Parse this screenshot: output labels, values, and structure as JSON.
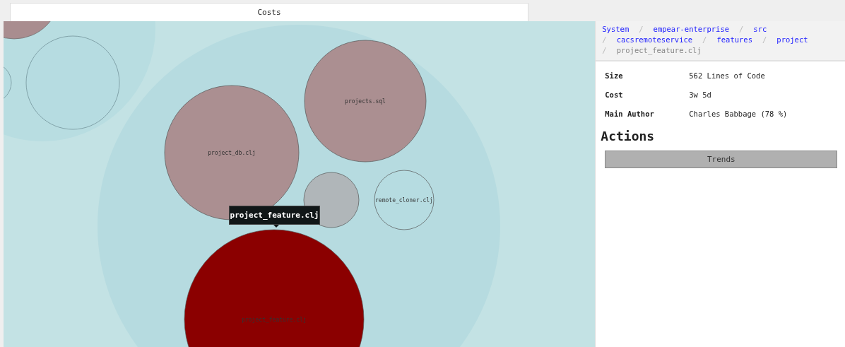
{
  "tabs": [
    {
      "label": "Costs",
      "selected": true
    }
  ],
  "files": [
    {
      "label": "projects.sql",
      "color": "#ab8f91"
    },
    {
      "label": "project_db.clj",
      "color": "#ab8f91"
    },
    {
      "color": "#b0b6b9"
    },
    {
      "label": "remote_cloner.clj",
      "color": "#b6dce1"
    },
    {
      "label": "project_feature.clj",
      "color": "#8b0000"
    }
  ],
  "tooltip": "project_feature.clj",
  "breadcrumb": [
    {
      "label": "System",
      "current": false
    },
    {
      "separator": "/",
      "label": "empear-enterprise",
      "current": false
    },
    {
      "separator": "/",
      "label": "src",
      "current": false
    },
    {
      "separator": "/",
      "label": "cacsremoteservice",
      "current": false
    },
    {
      "separator": "/",
      "label": "features",
      "current": false
    },
    {
      "separator": "/",
      "label": "project",
      "current": false
    },
    {
      "separator": "/",
      "label": "project_feature.clj",
      "current": true
    }
  ],
  "details": [
    {
      "label": "Size",
      "value": "562 Lines of Code"
    },
    {
      "label": "Cost",
      "value": "3w 5d"
    },
    {
      "label": "Main Author",
      "value": "Charles Babbage (78 %)"
    }
  ],
  "actions_title": "Actions",
  "actions": [
    "Trends"
  ]
}
